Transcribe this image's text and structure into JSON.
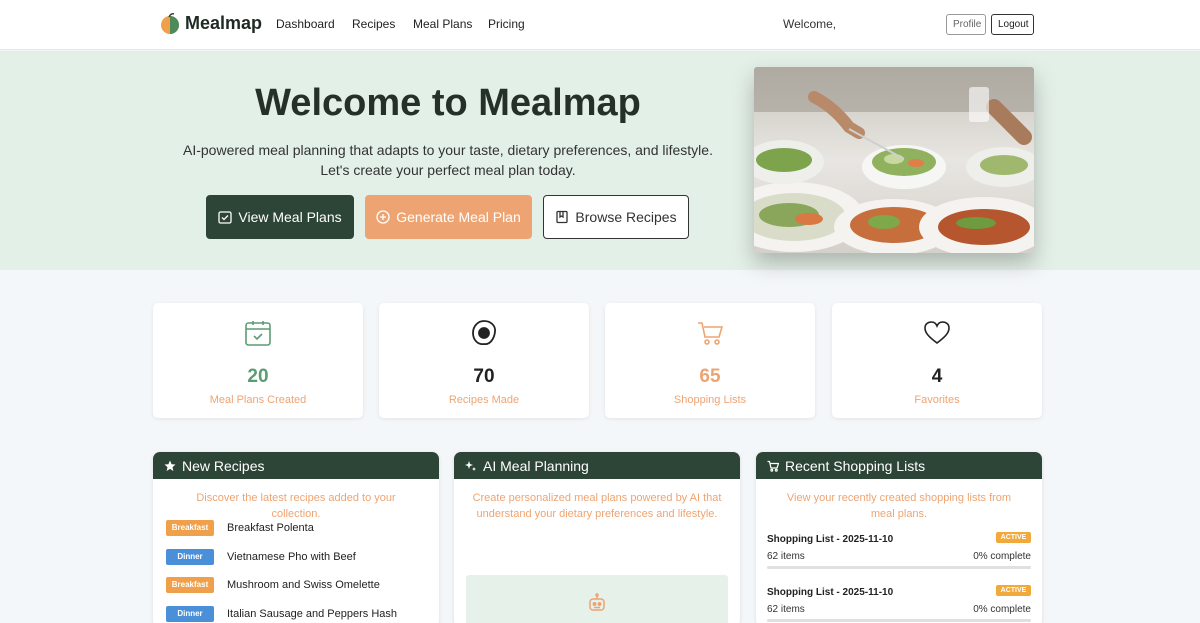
{
  "nav": {
    "brand": "Mealmap",
    "links": [
      "Dashboard",
      "Recipes",
      "Meal Plans",
      "Pricing"
    ],
    "welcome": "Welcome,",
    "profile_label": "Profile",
    "logout_label": "Logout"
  },
  "hero": {
    "title": "Welcome to Mealmap",
    "subtitle_line1": "AI-powered meal planning that adapts to your taste, dietary preferences, and lifestyle.",
    "subtitle_line2": "Let's create your perfect meal plan today.",
    "buttons": {
      "view_meal_plans": "View Meal Plans",
      "generate_meal_plan": "Generate Meal Plan",
      "browse_recipes": "Browse Recipes"
    },
    "image_icon": "food-photo"
  },
  "stats": [
    {
      "value": "20",
      "label": "Meal Plans Created",
      "icon": "calendar-check-icon",
      "color": "#5a9c74"
    },
    {
      "value": "70",
      "label": "Recipes Made",
      "icon": "egg-icon",
      "color": "#222222"
    },
    {
      "value": "65",
      "label": "Shopping Lists",
      "icon": "cart-icon",
      "color": "#eea472"
    },
    {
      "value": "4",
      "label": "Favorites",
      "icon": "heart-icon",
      "color": "#222222"
    }
  ],
  "panels": {
    "new_recipes": {
      "title": "New Recipes",
      "description": "Discover the latest recipes added to your collection.",
      "items": [
        {
          "tag": "Breakfast",
          "name": "Breakfast Polenta"
        },
        {
          "tag": "Dinner",
          "name": "Vietnamese Pho with Beef"
        },
        {
          "tag": "Breakfast",
          "name": "Mushroom and Swiss Omelette"
        },
        {
          "tag": "Dinner",
          "name": "Italian Sausage and Peppers Hash"
        }
      ]
    },
    "ai_planning": {
      "title": "AI Meal Planning",
      "description": "Create personalized meal plans powered by AI that understand your dietary preferences and lifestyle."
    },
    "shopping_lists": {
      "title": "Recent Shopping Lists",
      "description": "View your recently created shopping lists from meal plans.",
      "items": [
        {
          "title": "Shopping List - 2025-11-10",
          "status": "ACTIVE",
          "items": "62 items",
          "progress": "0% complete",
          "progress_value": 0
        },
        {
          "title": "Shopping List - 2025-11-10",
          "status": "ACTIVE",
          "items": "62 items",
          "progress": "0% complete",
          "progress_value": 0
        }
      ]
    }
  },
  "colors": {
    "primary": "#2d4536",
    "accent": "#eea472",
    "hero_bg": "#e3f0e7",
    "breakfast_tag": "#f0a04b",
    "dinner_tag": "#4a90d9",
    "badge": "#f2a93b"
  }
}
